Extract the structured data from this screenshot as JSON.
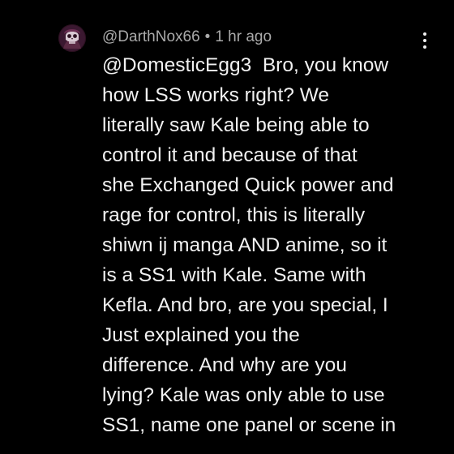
{
  "comment": {
    "author": "@DarthNox66",
    "separator": "•",
    "timestamp": "1 hr ago",
    "mention": "@DomesticEgg3",
    "lines": [
      "Bro, you know",
      "how LSS works right? We",
      "literally saw Kale being able to",
      "control it and because of that",
      "she Exchanged Quick power and",
      "rage for control, this is literally",
      "shiwn ij manga AND anime, so it",
      "is a SS1 with Kale. Same with",
      "Kefla. And bro, are you special, I",
      "Just explained you the",
      "difference. And why are you",
      "lying? Kale was only able to use",
      "SS1, name one panel or scene in"
    ]
  },
  "icons": {
    "avatar": "skull-avatar-icon",
    "menu": "more-vertical-icon"
  },
  "colors": {
    "background": "#000000",
    "text": "#f1f1f1",
    "meta": "#aaaaaa"
  }
}
